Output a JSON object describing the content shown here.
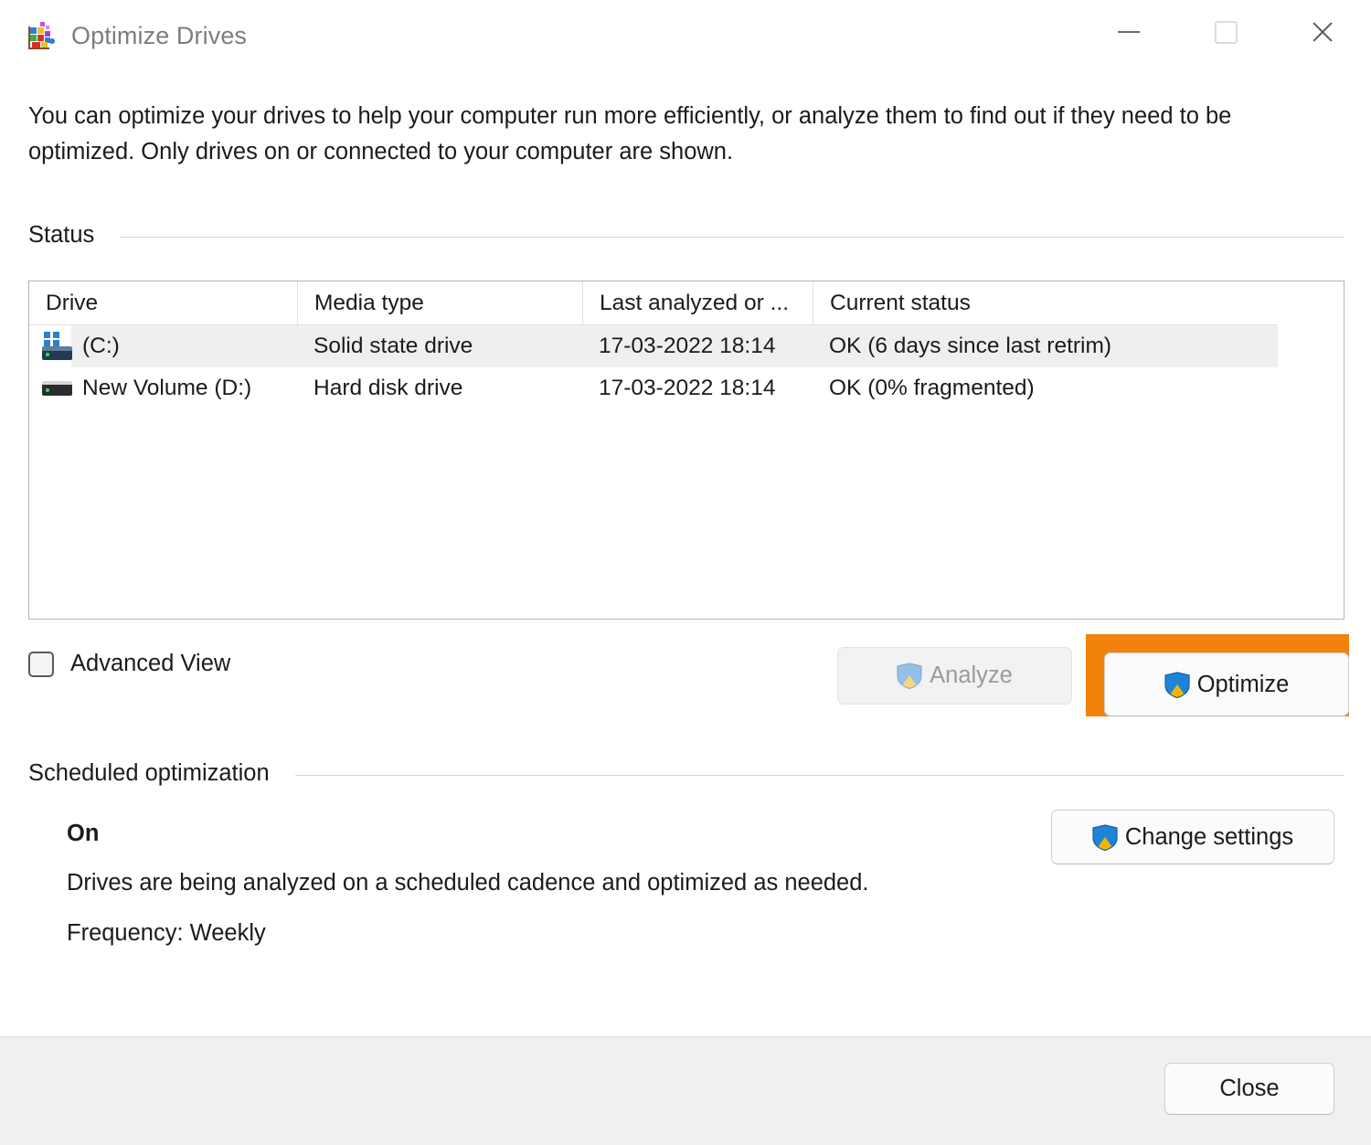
{
  "window": {
    "title": "Optimize Drives",
    "app_icon": "optimize-drives-icon",
    "controls": {
      "minimize": "minimize-icon",
      "maximize": "maximize-icon",
      "close": "close-icon"
    }
  },
  "intro": {
    "text": "You can optimize your drives to help your computer run more efficiently, or analyze them to find out if they need to be optimized. Only drives on or connected to your computer are shown."
  },
  "status_section": {
    "label": "Status",
    "columns": [
      "Drive",
      "Media type",
      "Last analyzed or ...",
      "Current status"
    ],
    "rows": [
      {
        "icon": "ssd-drive-icon",
        "drive": "(C:)",
        "media_type": "Solid state drive",
        "last_analyzed": "17-03-2022 18:14",
        "current_status": "OK (6 days since last retrim)",
        "selected": true
      },
      {
        "icon": "hard-disk-drive-icon",
        "drive": "New Volume (D:)",
        "media_type": "Hard disk drive",
        "last_analyzed": "17-03-2022 18:14",
        "current_status": "OK (0% fragmented)",
        "selected": false
      }
    ],
    "advanced_view": {
      "label": "Advanced View",
      "checked": false
    },
    "analyze_button": {
      "label": "Analyze",
      "enabled": false,
      "icon": "uac-shield-icon"
    },
    "optimize_button": {
      "label": "Optimize",
      "enabled": true,
      "icon": "uac-shield-icon",
      "highlight_color": "#f2820c"
    }
  },
  "scheduled_section": {
    "label": "Scheduled optimization",
    "state": "On",
    "description": "Drives are being analyzed on a scheduled cadence and optimized as needed.",
    "frequency": "Frequency: Weekly",
    "change_settings_button": {
      "label": "Change settings",
      "icon": "uac-shield-icon"
    }
  },
  "footer": {
    "close_button": "Close"
  }
}
